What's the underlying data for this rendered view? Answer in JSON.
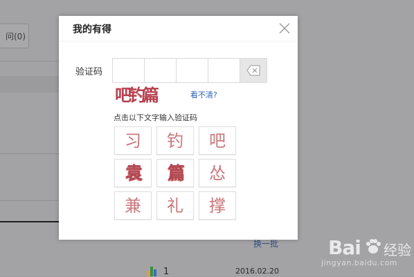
{
  "background": {
    "tab_label": "问(0)",
    "link_text": "换一批",
    "count": "1",
    "date": "2016.02.20"
  },
  "watermark": {
    "brand": "Bai",
    "brand_cn": "经验",
    "url": "jingyan.baidu.com"
  },
  "dialog": {
    "title": "我的有得",
    "code_label": "验证码",
    "refresh_link": "看不清?",
    "hint": "点击以下文字输入验证码",
    "captcha_text": "吧钓篇",
    "characters": [
      "习",
      "钓",
      "吧",
      "袁",
      "篇",
      "怂",
      "兼",
      "礼",
      "撑"
    ]
  },
  "colors": {
    "overlay": "#a3a2a4",
    "link": "#2b64b8",
    "captcha_red": "#c9777b"
  }
}
